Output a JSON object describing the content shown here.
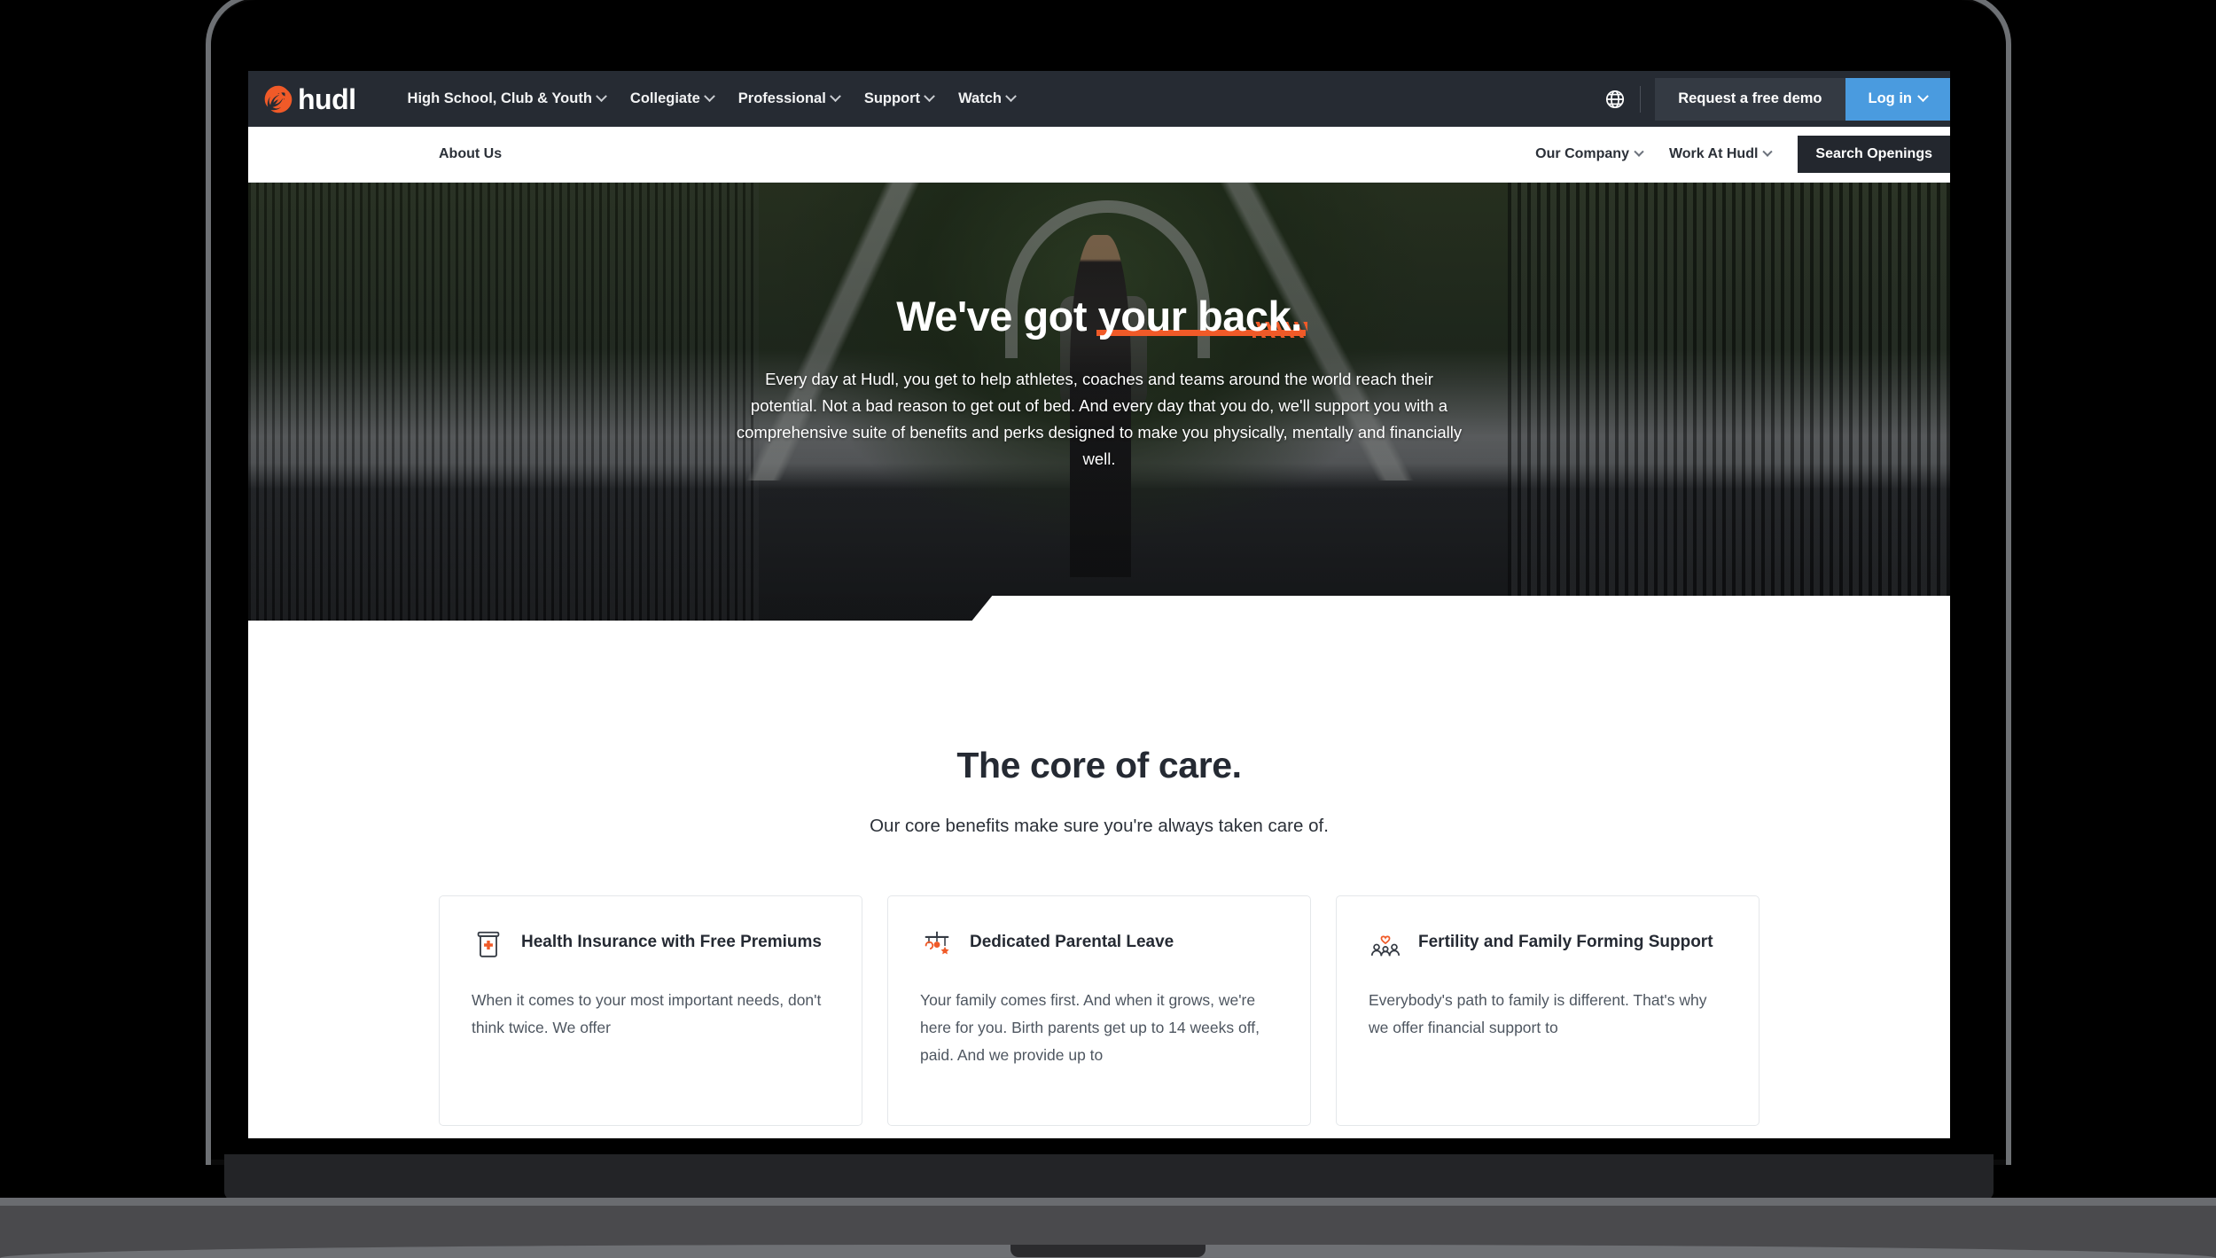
{
  "brand": {
    "logo_text": "hudl",
    "logo_icon": "hudl-logo-mark",
    "accent_orange": "#f05a28",
    "nav_dark": "#262b33",
    "login_blue": "#4a9bdf",
    "text_dark": "#252a33"
  },
  "top_nav": {
    "items": [
      {
        "label": "High School, Club & Youth",
        "has_caret": true
      },
      {
        "label": "Collegiate",
        "has_caret": true
      },
      {
        "label": "Professional",
        "has_caret": true
      },
      {
        "label": "Support",
        "has_caret": true
      },
      {
        "label": "Watch",
        "has_caret": true
      }
    ],
    "globe_icon": "globe-icon",
    "request_demo_label": "Request a free demo",
    "login_label": "Log in"
  },
  "sub_nav": {
    "about_label": "About Us",
    "items": [
      {
        "label": "Our Company",
        "has_caret": true
      },
      {
        "label": "Work At Hudl",
        "has_caret": true
      }
    ],
    "search_openings_label": "Search Openings"
  },
  "hero": {
    "title_lead": "We've got ",
    "title_accent": "your back.",
    "paragraph": "Every day at Hudl, you get to help athletes, coaches and teams around the world reach their potential. Not a bad reason to get out of bed. And every day that you do, we'll support you with a comprehensive suite of benefits and perks designed to make you physically, mentally and financially well."
  },
  "core_section": {
    "heading": "The core of care.",
    "subheading": "Our core benefits make sure you're always taken care of.",
    "cards": [
      {
        "icon": "medicine-jar-icon",
        "title": "Health Insurance with Free Premiums",
        "body": "When it comes to your most important needs, don't think twice. We offer"
      },
      {
        "icon": "baby-mobile-icon",
        "title": "Dedicated Parental Leave",
        "body": "Your family comes first. And when it grows, we're here for you. Birth parents get up to 14 weeks off, paid. And we provide up to"
      },
      {
        "icon": "family-heart-icon",
        "title": "Fertility and Family Forming Support",
        "body": "Everybody's path to family is different. That's why we offer financial support to"
      }
    ]
  }
}
